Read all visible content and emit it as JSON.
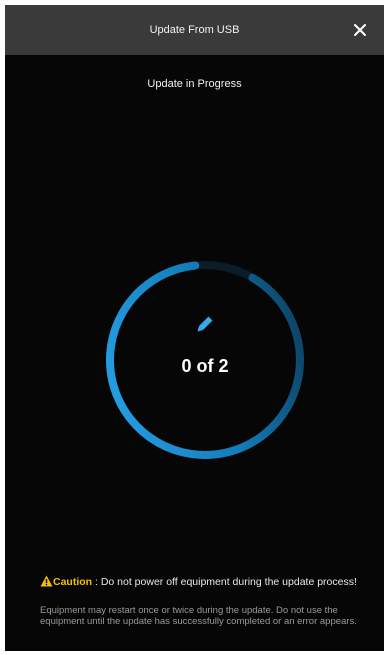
{
  "header": {
    "title": "Update From USB",
    "close_icon": "close-icon"
  },
  "status": {
    "title": "Update in Progress"
  },
  "progress": {
    "current": 0,
    "total": 2,
    "text": "0 of 2",
    "icon": "pencil-icon",
    "ring_fill_fraction": 0.9,
    "accent_color": "#1e9be0"
  },
  "caution": {
    "icon": "warning-triangle-icon",
    "label": "Caution",
    "message": " : Do not power off equipment during the update process!",
    "label_color": "#f2c200"
  },
  "note": {
    "text": "Equipment may restart once or twice during the update.  Do not use the equipment until the update has successfully completed or an error appears."
  }
}
